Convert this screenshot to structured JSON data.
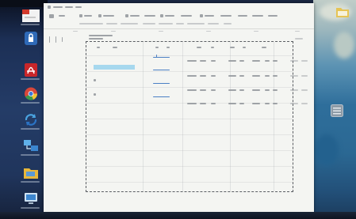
{
  "colors": {
    "desktop_left": "#20355c",
    "desktop_right": "#2e6e9b",
    "window_background": "#f4f5f2",
    "selected_cell": "#a6d8ee",
    "row_marker": "#4a7fc4",
    "print_area_border": "#5a5d62"
  },
  "desktop_icons_left": [
    {
      "icon": "app-window-icon"
    },
    {
      "icon": "shield-icon"
    },
    {
      "icon": "pdf-reader-icon"
    },
    {
      "icon": "chrome-icon"
    },
    {
      "icon": "sync-icon"
    },
    {
      "icon": "network-icon"
    },
    {
      "icon": "folder-icon"
    },
    {
      "icon": "computer-icon"
    }
  ],
  "desktop_icons_right": [
    {
      "icon": "folder-icon"
    },
    {
      "icon": "window-grid-icon"
    }
  ]
}
